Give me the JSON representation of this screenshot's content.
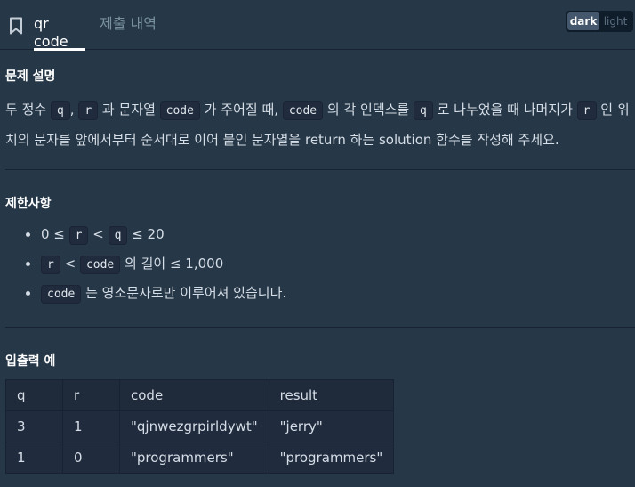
{
  "header": {
    "tabs": [
      {
        "label": "qr code",
        "active": true
      },
      {
        "label": "제출 내역",
        "active": false
      }
    ],
    "theme": {
      "dark_label": "dark",
      "light_label": "light",
      "selected": "dark"
    },
    "bookmark_icon": "bookmark-icon"
  },
  "description": {
    "title": "문제 설명",
    "parts": [
      "두 정수 ",
      "q",
      ", ",
      "r",
      " 과 문자열 ",
      "code",
      " 가 주어질 때, ",
      "code",
      " 의 각 인덱스를 ",
      "q",
      " 로 나누었을 때 나머지가 ",
      "r",
      " 인 위치의 문자를 앞에서부터 순서대로 이어 붙인 문자열을 return 하는 solution 함수를 작성해 주세요."
    ]
  },
  "constraints": {
    "title": "제한사항",
    "item1": [
      "0 ≤ ",
      "r",
      " < ",
      "q",
      " ≤ 20"
    ],
    "item2": [
      "r",
      " < ",
      "code",
      " 의 길이 ≤ 1,000"
    ],
    "item3": [
      "code",
      " 는 영소문자로만 이루어져 있습니다."
    ]
  },
  "examples": {
    "title": "입출력 예",
    "headers": [
      "q",
      "r",
      "code",
      "result"
    ],
    "rows": [
      [
        "3",
        "1",
        "\"qjnwezgrpirldywt\"",
        "\"jerry\""
      ],
      [
        "1",
        "0",
        "\"programmers\"",
        "\"programmers\""
      ]
    ]
  },
  "colors": {
    "background": "#263747",
    "text": "#d5dde6",
    "code_bg": "#202b3d",
    "divider": "#172334"
  }
}
